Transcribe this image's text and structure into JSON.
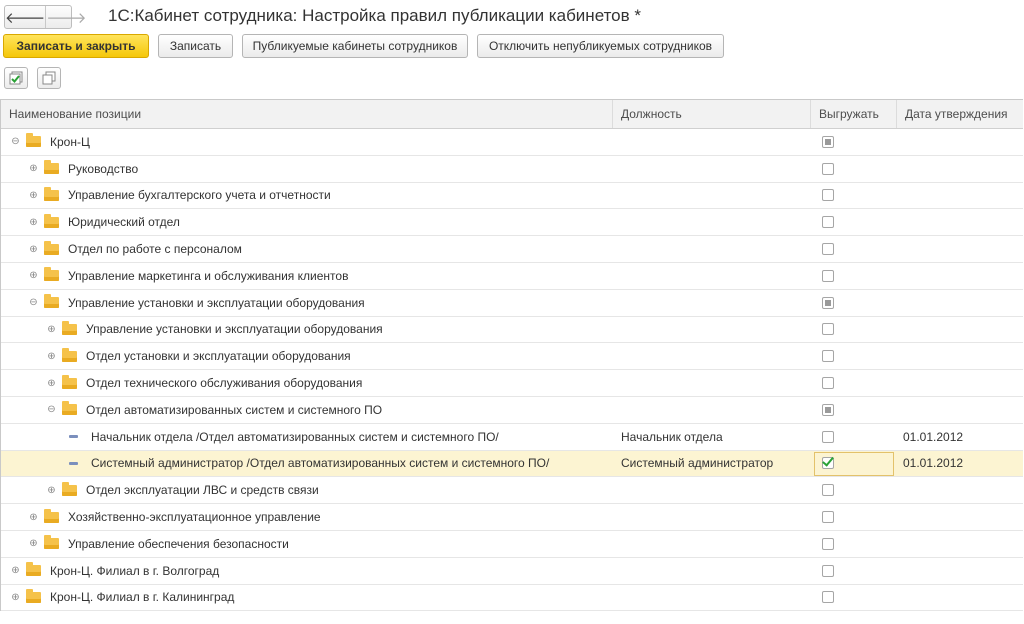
{
  "window": {
    "title": "1С:Кабинет сотрудника: Настройка правил публикации кабинетов *",
    "back_glyph": "🡐",
    "forward_glyph": "🡒"
  },
  "toolbar": {
    "save_close": "Записать и закрыть",
    "save": "Записать",
    "published": "Публикуемые кабинеты сотрудников",
    "disable": "Отключить непубликуемых сотрудников"
  },
  "table": {
    "columns": [
      "Наименование позиции",
      "Должность",
      "Выгружать",
      "Дата утверждения"
    ],
    "rows": [
      {
        "level": 0,
        "kind": "folder",
        "exp": "⊖",
        "name": "Крон-Ц",
        "position": "",
        "check": "partial",
        "date": ""
      },
      {
        "level": 1,
        "kind": "folder",
        "exp": "⊕",
        "name": "Руководство",
        "position": "",
        "check": "none",
        "date": ""
      },
      {
        "level": 1,
        "kind": "folder",
        "exp": "⊕",
        "name": "Управление бухгалтерского учета и отчетности",
        "position": "",
        "check": "none",
        "date": ""
      },
      {
        "level": 1,
        "kind": "folder",
        "exp": "⊕",
        "name": "Юридический отдел",
        "position": "",
        "check": "none",
        "date": ""
      },
      {
        "level": 1,
        "kind": "folder",
        "exp": "⊕",
        "name": "Отдел по работе с персоналом",
        "position": "",
        "check": "none",
        "date": ""
      },
      {
        "level": 1,
        "kind": "folder",
        "exp": "⊕",
        "name": "Управление маркетинга и обслуживания клиентов",
        "position": "",
        "check": "none",
        "date": ""
      },
      {
        "level": 1,
        "kind": "folder",
        "exp": "⊖",
        "name": "Управление установки и эксплуатации оборудования",
        "position": "",
        "check": "partial",
        "date": ""
      },
      {
        "level": 2,
        "kind": "folder",
        "exp": "⊕",
        "name": "Управление установки и эксплуатации оборудования",
        "position": "",
        "check": "none",
        "date": ""
      },
      {
        "level": 2,
        "kind": "folder",
        "exp": "⊕",
        "name": "Отдел установки и эксплуатации оборудования",
        "position": "",
        "check": "none",
        "date": ""
      },
      {
        "level": 2,
        "kind": "folder",
        "exp": "⊕",
        "name": "Отдел технического обслуживания оборудования",
        "position": "",
        "check": "none",
        "date": ""
      },
      {
        "level": 2,
        "kind": "folder",
        "exp": "⊖",
        "name": "Отдел автоматизированных систем и системного ПО",
        "position": "",
        "check": "partial",
        "date": ""
      },
      {
        "level": 3,
        "kind": "leaf",
        "exp": "",
        "name": "Начальник отдела /Отдел автоматизированных систем и системного ПО/",
        "position": "Начальник отдела",
        "check": "none",
        "date": "01.01.2012"
      },
      {
        "level": 3,
        "kind": "leaf",
        "exp": "",
        "name": "Системный администратор /Отдел автоматизированных систем и системного ПО/",
        "position": "Системный администратор",
        "check": "checked",
        "date": "01.01.2012",
        "selected": true
      },
      {
        "level": 2,
        "kind": "folder",
        "exp": "⊕",
        "name": "Отдел эксплуатации ЛВС и средств связи",
        "position": "",
        "check": "none",
        "date": ""
      },
      {
        "level": 1,
        "kind": "folder",
        "exp": "⊕",
        "name": "Хозяйственно-эксплуатационное управление",
        "position": "",
        "check": "none",
        "date": ""
      },
      {
        "level": 1,
        "kind": "folder",
        "exp": "⊕",
        "name": "Управление обеспечения безопасности",
        "position": "",
        "check": "none",
        "date": ""
      },
      {
        "level": 0,
        "kind": "folder",
        "exp": "⊕",
        "name": "Крон-Ц. Филиал в г. Волгоград",
        "position": "",
        "check": "none",
        "date": ""
      },
      {
        "level": 0,
        "kind": "folder",
        "exp": "⊕",
        "name": "Крон-Ц. Филиал в г. Калининград",
        "position": "",
        "check": "none",
        "date": ""
      }
    ]
  }
}
